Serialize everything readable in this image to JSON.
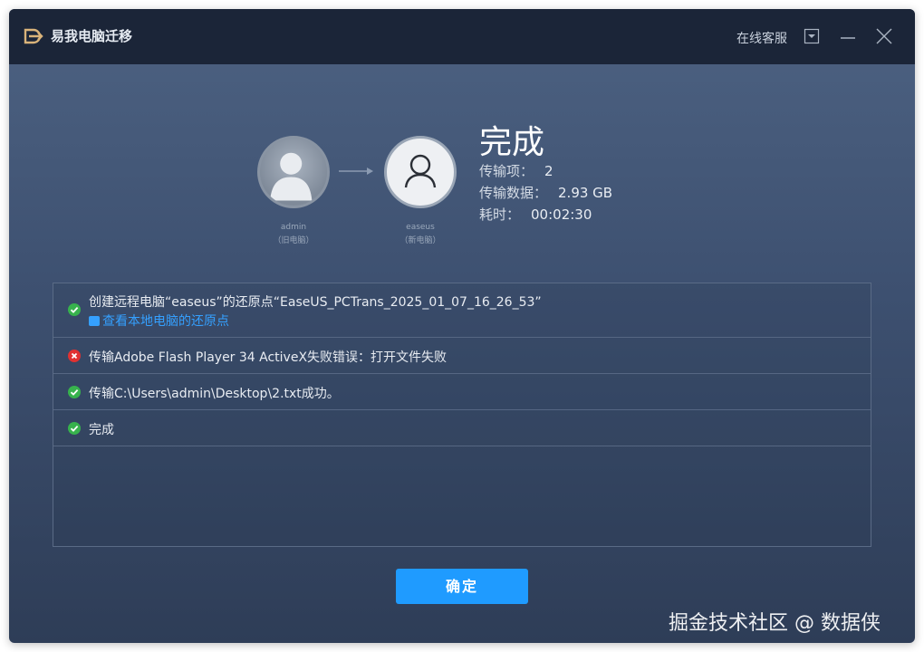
{
  "app": {
    "title": "易我电脑迁移"
  },
  "titlebar": {
    "support_label": "在线客服"
  },
  "transfer": {
    "source": {
      "name": "admin",
      "sub": "（旧电脑）"
    },
    "target": {
      "name": "easeus",
      "sub": "（新电脑）"
    }
  },
  "summary": {
    "title": "完成",
    "items_label": "传输项：",
    "items_value": "2",
    "data_label": "传输数据：",
    "data_value": "2.93 GB",
    "time_label": "耗时：",
    "time_value": "00:02:30"
  },
  "log": [
    {
      "status": "success",
      "text": "创建远程电脑“easeus”的还原点“EaseUS_PCTrans_2025_01_07_16_26_53”",
      "link": "查看本地电脑的还原点"
    },
    {
      "status": "error",
      "text": "传输Adobe Flash Player 34 ActiveX失败错误：打开文件失败"
    },
    {
      "status": "success",
      "text": "传输C:\\Users\\admin\\Desktop\\2.txt成功。"
    },
    {
      "status": "success",
      "text": "完成"
    }
  ],
  "footer": {
    "confirm_label": "确定"
  },
  "watermark": {
    "text": "掘金技术社区 @ 数据侠"
  },
  "colors": {
    "accent": "#1f9bff",
    "success": "#37b24d",
    "error": "#e03131",
    "titlebar": "#1b2538"
  }
}
